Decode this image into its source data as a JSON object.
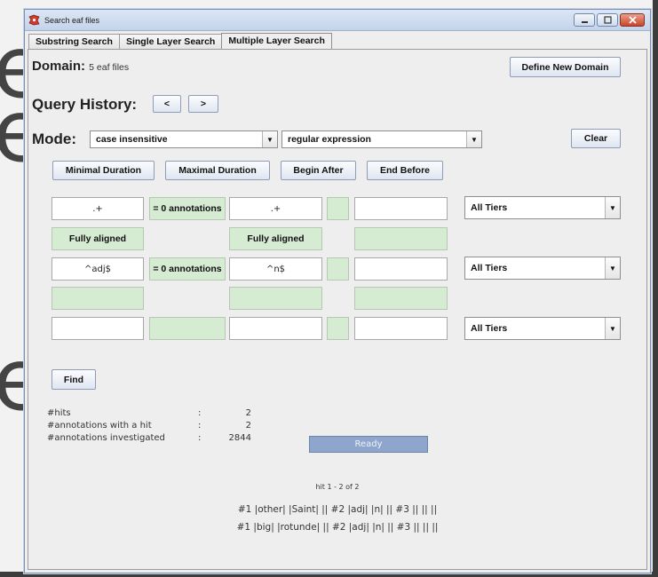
{
  "window": {
    "title": "Search eaf files"
  },
  "tabs": [
    {
      "label": "Substring Search"
    },
    {
      "label": "Single Layer Search"
    },
    {
      "label": "Multiple Layer Search"
    }
  ],
  "domain": {
    "label": "Domain:",
    "value": "5 eaf files",
    "define_button": "Define New Domain"
  },
  "history": {
    "label": "Query History:",
    "prev_button": "<",
    "next_button": ">"
  },
  "mode": {
    "label": "Mode:",
    "case_select": "case insensitive",
    "type_select": "regular expression",
    "clear_button": "Clear"
  },
  "constraints": {
    "min_duration": "Minimal Duration",
    "max_duration": "Maximal Duration",
    "begin_after": "Begin After",
    "end_before": "End Before"
  },
  "rows": [
    {
      "field1": ".+",
      "relation": "= 0 annotations",
      "field2": ".+",
      "field3": "",
      "tier": "All Tiers"
    },
    {
      "align1": "Fully aligned",
      "align2": "Fully aligned"
    },
    {
      "field1": "^adj$",
      "relation": "= 0 annotations",
      "field2": "^n$",
      "field3": "",
      "tier": "All Tiers"
    },
    {},
    {
      "field1": "",
      "relation": "",
      "field2": "",
      "field3": "",
      "tier": "All Tiers"
    }
  ],
  "find_button": "Find",
  "stats": {
    "hits_label": "#hits",
    "hits_value": "2",
    "ann_hit_label": "#annotations with a hit",
    "ann_hit_value": "2",
    "ann_inv_label": "#annotations investigated",
    "ann_inv_value": "2844",
    "colon": ":"
  },
  "status": "Ready",
  "results": {
    "range": "hit 1 - 2 of 2",
    "lines": [
      "#1 |other| |Saint| ||  #2 |adj| |n| ||  #3 || || ||",
      "#1 |big| |rotunde| ||  #2 |adj| |n| ||  #3 || || ||"
    ]
  }
}
